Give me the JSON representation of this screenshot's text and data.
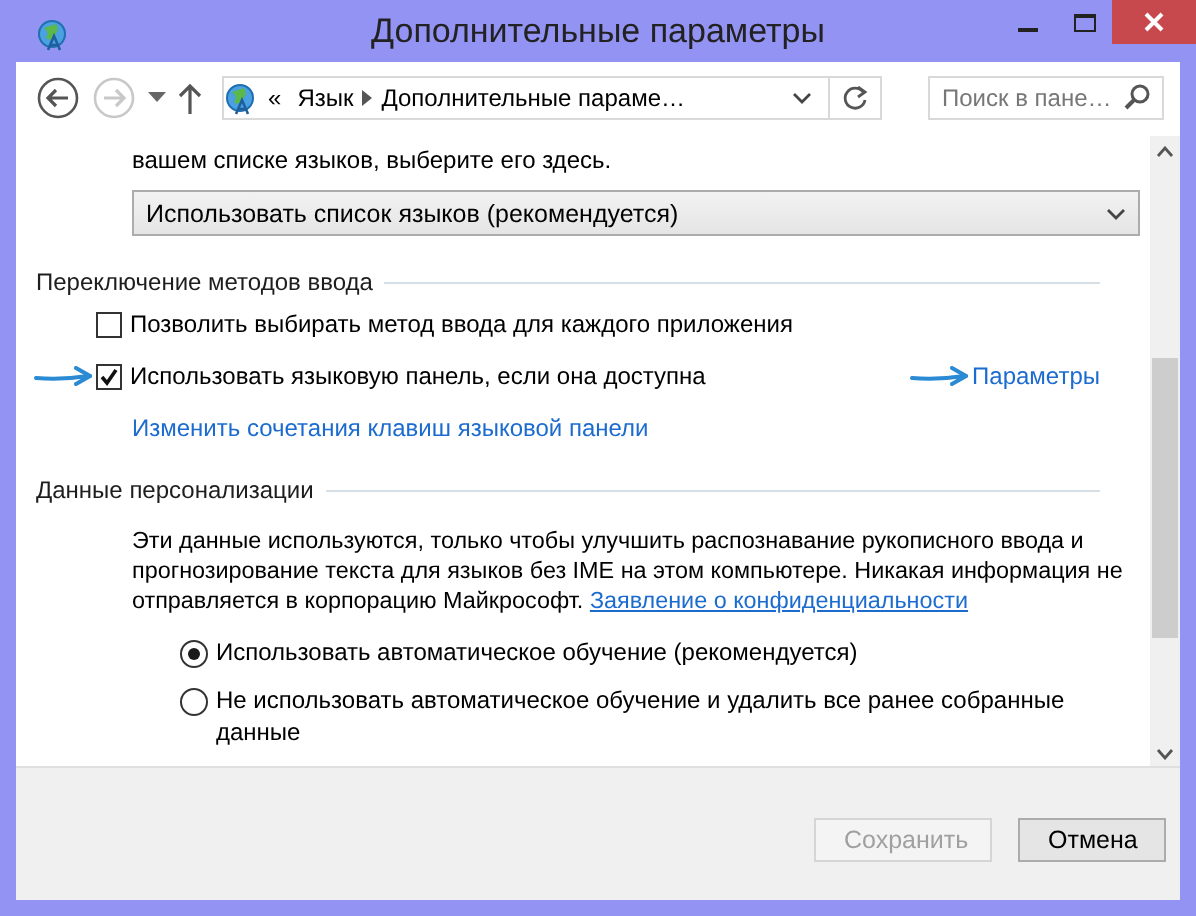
{
  "window": {
    "title": "Дополнительные параметры"
  },
  "navigation": {
    "back_disabled": false,
    "forward_disabled": true
  },
  "address_bar": {
    "overflow": "«",
    "crumbs": [
      "Язык",
      "Дополнительные параме…"
    ]
  },
  "search": {
    "placeholder": "Поиск в пане…"
  },
  "content": {
    "partial_text": "вашем списке языков, выберите его здесь.",
    "dropdown": {
      "value": "Использовать список языков (рекомендуется)"
    },
    "sections": [
      {
        "title": "Переключение методов ввода",
        "items": [
          {
            "kind": "checkbox",
            "label": "Позволить выбирать метод ввода для каждого приложения",
            "checked": false,
            "annotated": false
          },
          {
            "kind": "checkbox",
            "label": "Использовать языковую панель, если она доступна",
            "checked": true,
            "annotated": true,
            "link": "Параметры"
          },
          {
            "kind": "link",
            "label": "Изменить сочетания клавиш языковой панели"
          }
        ]
      },
      {
        "title": "Данные персонализации",
        "items": [
          {
            "kind": "paragraph",
            "text": "Эти данные используются, только чтобы улучшить распознавание рукописного ввода и прогнозирование текста для языков без IME на этом компьютере. Никакая информация не отправляется в корпорацию Майкрософт.",
            "link": "Заявление о конфиденциальности"
          },
          {
            "kind": "radio",
            "label": "Использовать автоматическое обучение (рекомендуется)",
            "selected": true
          },
          {
            "kind": "radio",
            "label": "Не использовать автоматическое обучение и удалить все ранее собранные данные",
            "selected": false
          }
        ]
      }
    ]
  },
  "buttons": [
    {
      "label": "Сохранить",
      "disabled": true
    },
    {
      "label": "Отмена",
      "disabled": false
    }
  ]
}
